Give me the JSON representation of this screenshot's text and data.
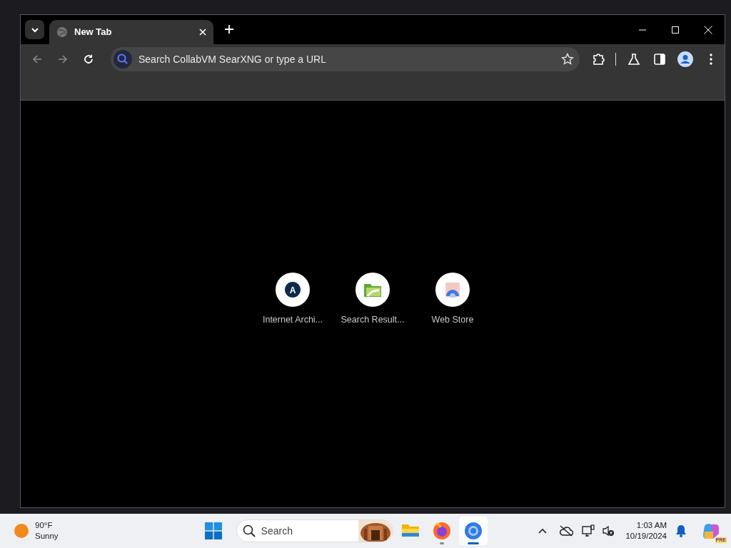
{
  "tabs": [
    {
      "title": "New Tab",
      "selected": true
    }
  ],
  "toolbar": {
    "back_disabled": true,
    "forward_disabled": true
  },
  "address_bar": {
    "placeholder": "Search CollabVM SearXNG or type a URL"
  },
  "shortcuts": [
    {
      "label": "Internet Archi...",
      "kind": "letter",
      "letter": "A"
    },
    {
      "label": "Search Result...",
      "kind": "folder"
    },
    {
      "label": "Web Store",
      "kind": "store"
    }
  ],
  "taskbar": {
    "weather": {
      "temperature": "90°F",
      "condition": "Sunny"
    },
    "search": {
      "placeholder": "Search"
    },
    "apps": [
      {
        "kind": "folder",
        "running": false,
        "active": false
      },
      {
        "kind": "fox",
        "running": true,
        "active": false
      },
      {
        "kind": "browser",
        "running": true,
        "active": true
      }
    ],
    "clock": {
      "time": "1:03 AM",
      "date": "10/19/2024"
    },
    "copilot_badge": "PRE"
  }
}
